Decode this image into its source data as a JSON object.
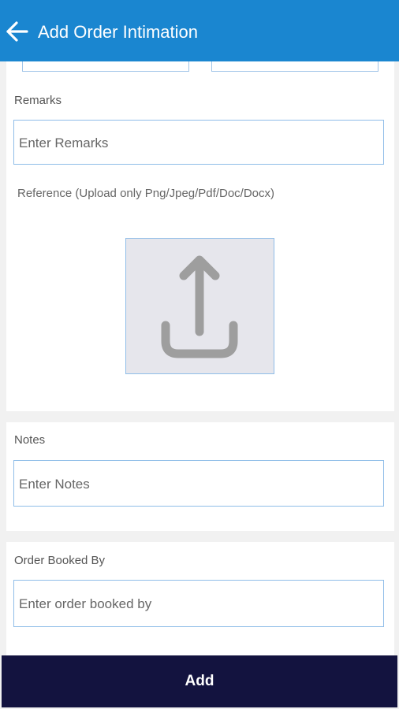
{
  "header": {
    "title": "Add Order Intimation",
    "back_icon": "arrow-left-icon",
    "background": "#1a86d0"
  },
  "remarks": {
    "label": "Remarks",
    "placeholder": "Enter Remarks"
  },
  "reference": {
    "label": "Reference (Upload only Png/Jpeg/Pdf/Doc/Docx)",
    "upload_icon": "upload-icon"
  },
  "notes": {
    "label": "Notes",
    "placeholder": "Enter Notes"
  },
  "order_booked_by": {
    "label": "Order Booked By",
    "placeholder": "Enter order booked by"
  },
  "footer": {
    "add_label": "Add",
    "background": "#13133f"
  }
}
